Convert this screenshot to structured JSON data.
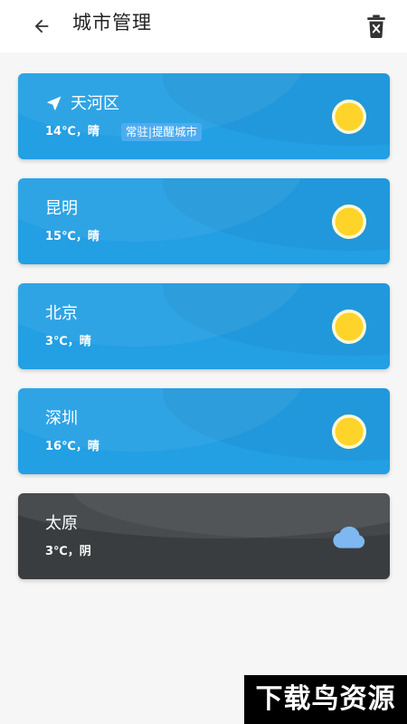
{
  "header": {
    "title": "城市管理",
    "back_icon": "arrow-left-icon",
    "delete_icon": "trash-icon"
  },
  "cities": [
    {
      "name": "天河区",
      "weather": "14℃，晴",
      "tag": "常驻|提醒城市",
      "condition": "sunny",
      "located": true,
      "icon": "sun-icon"
    },
    {
      "name": "昆明",
      "weather": "15℃，晴",
      "condition": "sunny",
      "icon": "sun-icon"
    },
    {
      "name": "北京",
      "weather": "3℃，晴",
      "condition": "sunny",
      "icon": "sun-icon"
    },
    {
      "name": "深圳",
      "weather": "16℃，晴",
      "condition": "sunny",
      "icon": "sun-icon"
    },
    {
      "name": "太原",
      "weather": "3℃，阴",
      "condition": "cloudy",
      "icon": "cloud-icon"
    }
  ],
  "colors": {
    "sunny_card": "#239fe4",
    "cloudy_card": "#3a3d40",
    "tag_bg": "#4dacf0",
    "sun_fill": "#ffd42a",
    "cloud_fill": "#7fb8f0"
  },
  "watermark": {
    "text": "下载鸟资源"
  }
}
